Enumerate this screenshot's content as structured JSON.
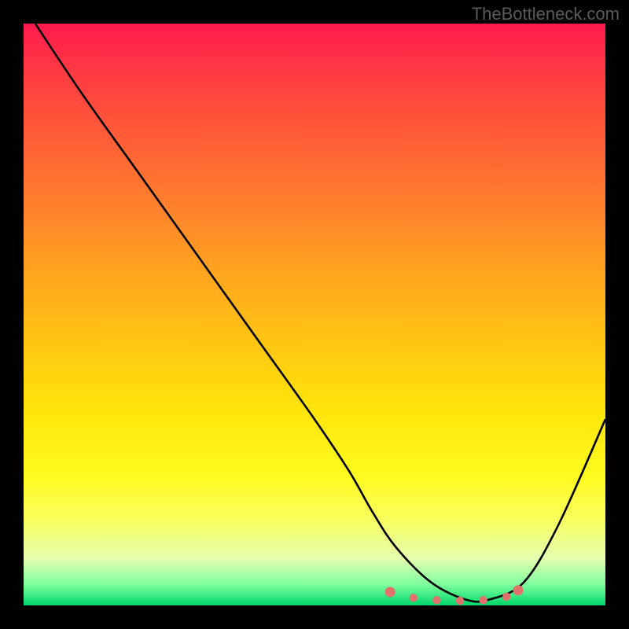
{
  "watermark": "TheBottleneck.com",
  "chart_data": {
    "type": "line",
    "title": "",
    "xlabel": "",
    "ylabel": "",
    "xlim": [
      0,
      100
    ],
    "ylim": [
      0,
      100
    ],
    "series": [
      {
        "name": "bottleneck-curve",
        "x": [
          2,
          10,
          20,
          30,
          40,
          50,
          56,
          60,
          64,
          70,
          76,
          80,
          86,
          92,
          100
        ],
        "values": [
          100,
          88,
          74,
          60,
          46,
          32,
          23,
          16,
          10,
          4,
          1,
          1,
          4,
          14,
          32
        ]
      }
    ],
    "markers": {
      "name": "optimal-range",
      "x": [
        63,
        67,
        71,
        75,
        79,
        83,
        85
      ],
      "values": [
        2.3,
        1.3,
        0.9,
        0.8,
        0.9,
        1.5,
        2.6
      ],
      "color": "#e0726b"
    },
    "gradient_stops": [
      {
        "pos": 0,
        "color": "#ff1a4d"
      },
      {
        "pos": 7,
        "color": "#ff3545"
      },
      {
        "pos": 18,
        "color": "#ff5838"
      },
      {
        "pos": 30,
        "color": "#ff7c2e"
      },
      {
        "pos": 42,
        "color": "#ffa220"
      },
      {
        "pos": 55,
        "color": "#ffc612"
      },
      {
        "pos": 67,
        "color": "#ffe60a"
      },
      {
        "pos": 78,
        "color": "#fffb20"
      },
      {
        "pos": 85,
        "color": "#f9ff5c"
      },
      {
        "pos": 92,
        "color": "#e4ffb0"
      },
      {
        "pos": 96.5,
        "color": "#7cff9e"
      },
      {
        "pos": 100,
        "color": "#00d66a"
      }
    ]
  }
}
